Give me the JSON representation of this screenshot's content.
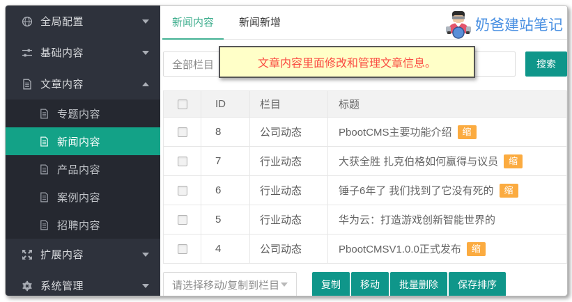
{
  "colors": {
    "sidebar_bg": "#2e323c",
    "sidebar_submenu_bg": "#252830",
    "selected_item": "#13a287",
    "accent_button": "#0f968a",
    "tab_active": "#3fae8e",
    "badge": "#fbab40",
    "tooltip_bg": "#ffffc8",
    "tooltip_text": "#fa4b42",
    "watermark_text": "#4a90e2"
  },
  "sidebar": {
    "items_top": [
      {
        "label": "全局配置",
        "icon": "globe-icon",
        "chevron": "down"
      },
      {
        "label": "基础内容",
        "icon": "sliders-icon",
        "chevron": "down"
      },
      {
        "label": "文章内容",
        "icon": "document-icon",
        "chevron": "up",
        "expanded": true
      }
    ],
    "submenu": [
      {
        "label": "专题内容",
        "icon": "document-icon",
        "selected": false
      },
      {
        "label": "新闻内容",
        "icon": "document-icon",
        "selected": true
      },
      {
        "label": "产品内容",
        "icon": "document-icon",
        "selected": false
      },
      {
        "label": "案例内容",
        "icon": "document-icon",
        "selected": false
      },
      {
        "label": "招聘内容",
        "icon": "document-icon",
        "selected": false
      }
    ],
    "items_bottom": [
      {
        "label": "扩展内容",
        "icon": "expand-icon",
        "chevron": "down"
      },
      {
        "label": "系统管理",
        "icon": "gear-icon",
        "chevron": "down"
      }
    ]
  },
  "header": {
    "tabs": [
      {
        "label": "新闻内容",
        "active": true
      },
      {
        "label": "新闻新增",
        "active": false
      }
    ],
    "watermark": "奶爸建站笔记"
  },
  "toolbar": {
    "category_select": {
      "value": "全部栏目"
    },
    "search_input": {
      "value": ""
    },
    "search_button": "搜索",
    "tooltip": "文章内容里面修改和管理文章信息。"
  },
  "table": {
    "headers": {
      "id": "ID",
      "category": "栏目",
      "title": "标题"
    },
    "rows": [
      {
        "id": "8",
        "category": "公司动态",
        "title": "PbootCMS主要功能介绍",
        "badge": "缩"
      },
      {
        "id": "7",
        "category": "行业动态",
        "title": "大获全胜 扎克伯格如何赢得与议员",
        "badge": "缩"
      },
      {
        "id": "6",
        "category": "行业动态",
        "title": "锤子6年了 我们找到了它没有死的",
        "badge": "缩"
      },
      {
        "id": "5",
        "category": "行业动态",
        "title": "华为云：打造游戏创新智能世界的",
        "badge": ""
      },
      {
        "id": "4",
        "category": "公司动态",
        "title": "PbootCMSV1.0.0正式发布",
        "badge": "缩"
      }
    ]
  },
  "footer": {
    "select_placeholder": "请选择移动/复制到栏目",
    "buttons": [
      "复制",
      "移动",
      "批量删除",
      "保存排序"
    ]
  }
}
